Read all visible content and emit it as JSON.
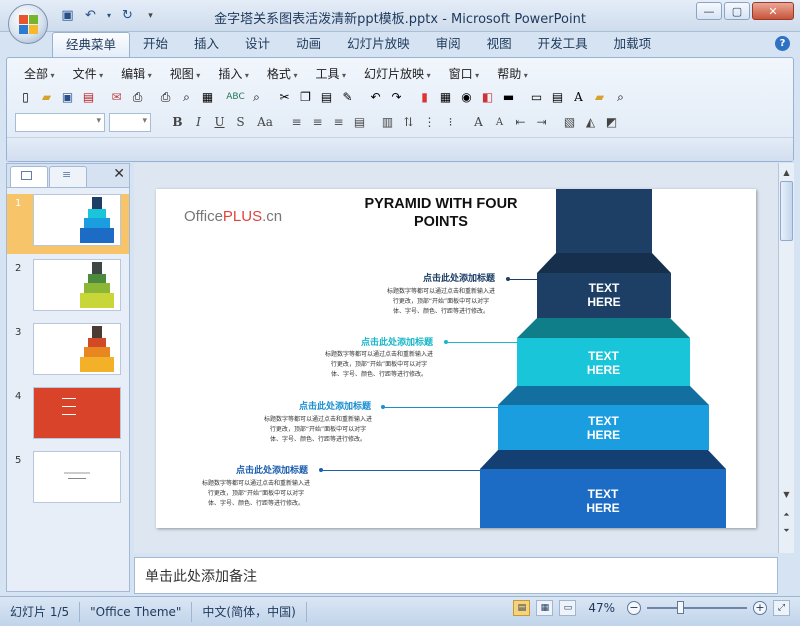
{
  "window": {
    "title": "金字塔关系图表活泼清新ppt模板.pptx - Microsoft PowerPoint"
  },
  "tabs": [
    {
      "label": "经典菜单",
      "active": true
    },
    {
      "label": "开始"
    },
    {
      "label": "插入"
    },
    {
      "label": "设计"
    },
    {
      "label": "动画"
    },
    {
      "label": "幻灯片放映"
    },
    {
      "label": "审阅"
    },
    {
      "label": "视图"
    },
    {
      "label": "开发工具"
    },
    {
      "label": "加载项"
    }
  ],
  "menus": [
    "全部",
    "文件",
    "编辑",
    "视图",
    "插入",
    "格式",
    "工具",
    "幻灯片放映",
    "窗口",
    "帮助"
  ],
  "slide_pane": {
    "thumbnails": [
      {
        "num": "1",
        "active": true
      },
      {
        "num": "2"
      },
      {
        "num": "3"
      },
      {
        "num": "4"
      },
      {
        "num": "5"
      }
    ]
  },
  "slide": {
    "logo_pre": "Office",
    "logo_brand": "PLUS",
    "logo_post": ".cn",
    "title_line1": "PYRAMID WITH FOUR",
    "title_line2": "POINTS",
    "steps": [
      {
        "text_line1": "TEXT",
        "text_line2": "HERE",
        "color": "#1d3f66",
        "top_color": "#152f4d"
      },
      {
        "text_line1": "TEXT",
        "text_line2": "HERE",
        "color": "#19c6d9",
        "top_color": "#0f7e88"
      },
      {
        "text_line1": "TEXT",
        "text_line2": "HERE",
        "color": "#1a9ee0",
        "top_color": "#136f9f"
      },
      {
        "text_line1": "TEXT",
        "text_line2": "HERE",
        "color": "#1c6cc6",
        "top_color": "#143f73"
      }
    ],
    "labels": [
      {
        "title": "点击此处添加标题",
        "body_line1": "标题数字等都可以通过点击和重新输入进",
        "body_line2": "行更改，顶部“开始”面板中可以对字",
        "body_line3": "体、字号、颜色、行距等进行修改。",
        "color": "#1d3f66"
      },
      {
        "title": "点击此处添加标题",
        "body_line1": "标题数字等都可以通过点击和重新输入进",
        "body_line2": "行更改，顶部“开始”面板中可以对字",
        "body_line3": "体、字号、颜色、行距等进行修改。",
        "color": "#19b7c9"
      },
      {
        "title": "点击此处添加标题",
        "body_line1": "标题数字等都可以通过点击和重新输入进",
        "body_line2": "行更改，顶部“开始”面板中可以对字",
        "body_line3": "体、字号、颜色、行距等进行修改。",
        "color": "#1a8fd0"
      },
      {
        "title": "点击此处添加标题",
        "body_line1": "标题数字等都可以通过点击和重新输入进",
        "body_line2": "行更改，顶部“开始”面板中可以对字",
        "body_line3": "体、字号、颜色、行距等进行修改。",
        "color": "#1c5fb0"
      }
    ]
  },
  "notes": {
    "placeholder": "单击此处添加备注"
  },
  "status": {
    "slide_info": "幻灯片 1/5",
    "theme": "\"Office Theme\"",
    "language": "中文(简体，中国)",
    "zoom": "47%"
  }
}
